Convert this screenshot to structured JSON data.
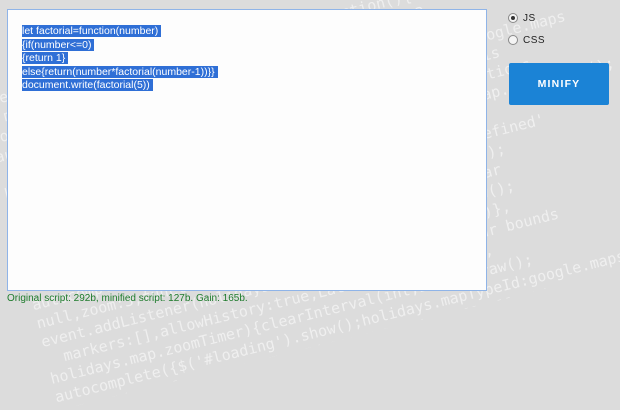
{
  "code_lines": [
    "let factorial=function(number)",
    "{if(number<=0)",
    "{return 1}",
    "else{return(number*factorial(number-1))}}",
    "document.write(factorial(5))"
  ],
  "options": [
    {
      "label": "JS",
      "checked": true
    },
    {
      "label": "CSS",
      "checked": false
    }
  ],
  "minify_button": "MINIFY",
  "status": "Original script: 292b, minified script: 127b. Gain: 165b.",
  "colors": {
    "button": "#1b83d6",
    "selection": "#2f6fd6",
    "status": "#1e7b2c"
  }
}
